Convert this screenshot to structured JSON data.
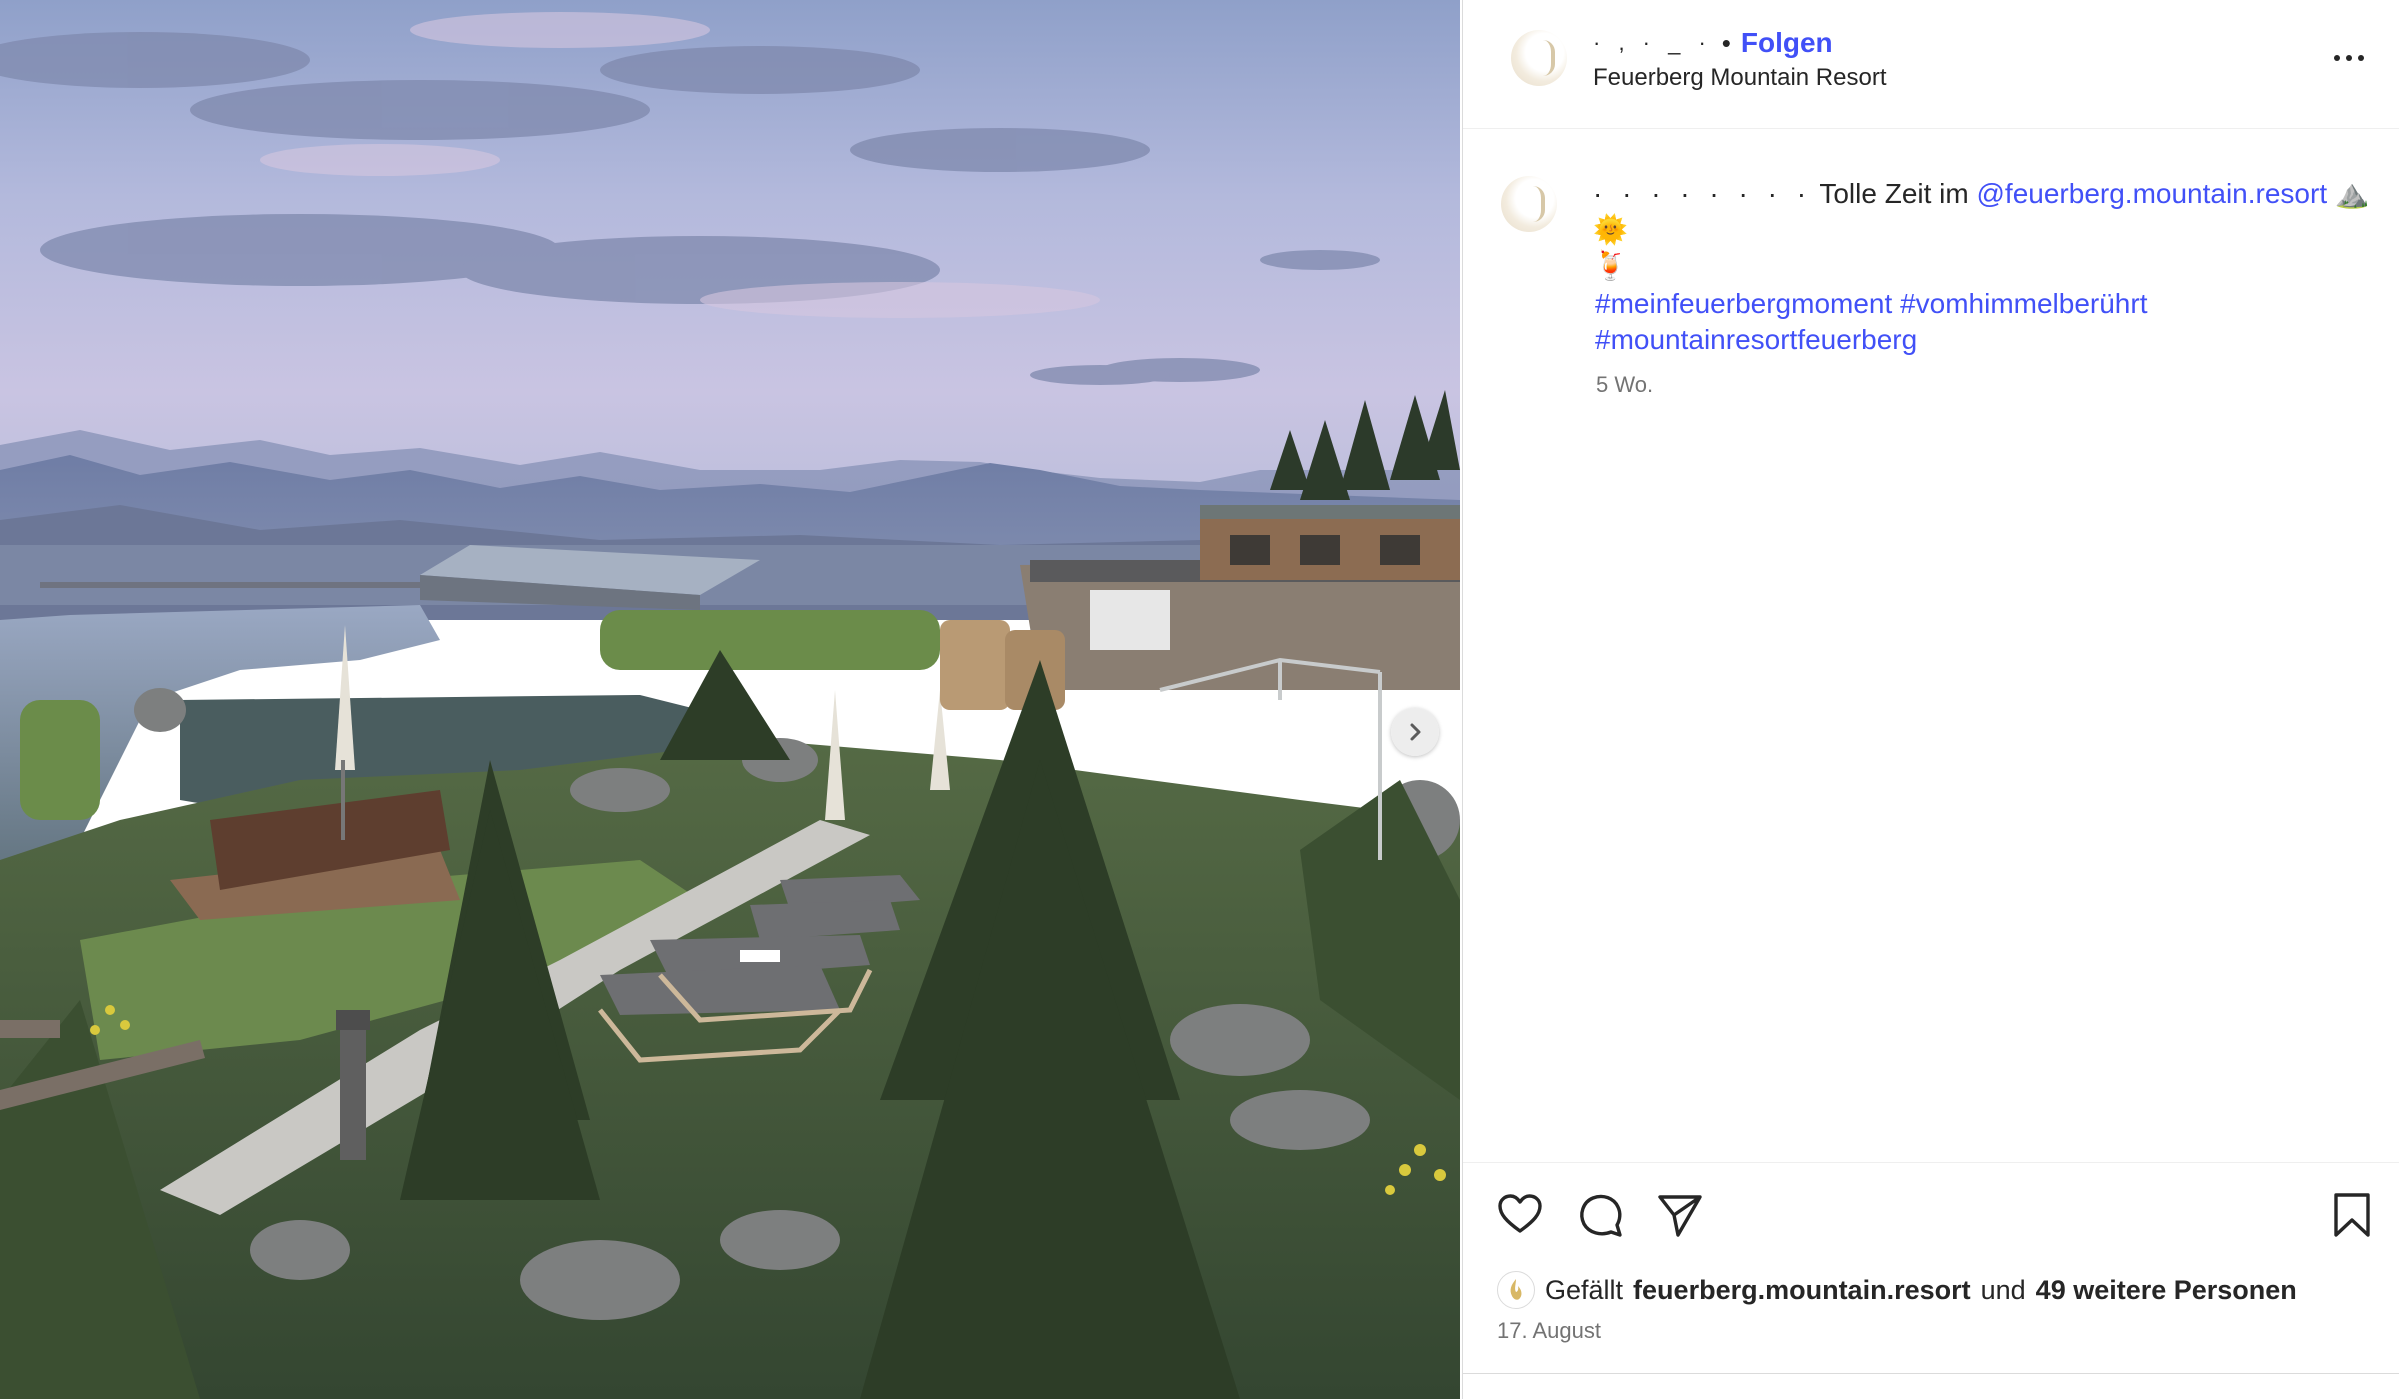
{
  "post": {
    "image_alt": "Mountain resort garden with pond, sun loungers and alpine view at dusk",
    "next_icon": "chevron-right-icon"
  },
  "header": {
    "username_redacted": "· ,  ·  _  ·",
    "separator": "•",
    "follow_label": "Folgen",
    "location": "Feuerberg Mountain Resort",
    "more_icon": "more-horizontal-icon"
  },
  "caption": {
    "username_redacted": "·  ·  ·  ·  ·  ·  ·  ·",
    "text": "Tolle Zeit im",
    "mention": "@feuerberg.mountain.resort",
    "emojis": "⛰️🌞",
    "emoji_line2": "🍹",
    "hashtags": [
      "#meinfeuerbergmoment",
      "#vomhimmelberührt",
      "#mountainresortfeuerberg"
    ],
    "time_ago": "5 Wo."
  },
  "actions": {
    "like_icon": "heart-icon",
    "comment_icon": "comment-icon",
    "share_icon": "send-icon",
    "save_icon": "bookmark-icon"
  },
  "likes": {
    "prefix": "Gefällt",
    "liker": "feuerberg.mountain.resort",
    "connector": "und",
    "others": "49 weitere Personen"
  },
  "date": "17. August",
  "colors": {
    "link": "#4150f7",
    "text": "#262626",
    "muted": "#737373",
    "border": "#dbdbdb"
  }
}
